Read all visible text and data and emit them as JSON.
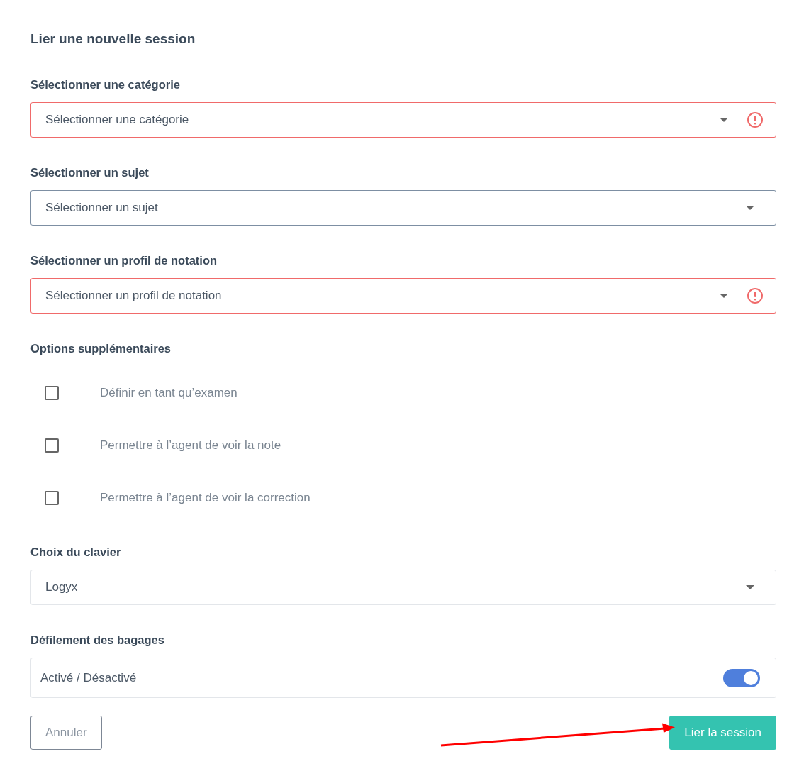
{
  "title": "Lier une nouvelle session",
  "selects": [
    {
      "label": "Sélectionner une catégorie",
      "placeholder": "Sélectionner une catégorie",
      "error": true,
      "focused": false
    },
    {
      "label": "Sélectionner un sujet",
      "placeholder": "Sélectionner un sujet",
      "error": false,
      "focused": true
    },
    {
      "label": "Sélectionner un profil de notation",
      "placeholder": "Sélectionner un profil de notation",
      "error": true,
      "focused": false
    }
  ],
  "options": {
    "label": "Options supplémentaires",
    "items": [
      {
        "label": "Définir en tant qu’examen",
        "checked": false
      },
      {
        "label": "Permettre à l’agent de voir la note",
        "checked": false
      },
      {
        "label": "Permettre à l’agent de voir la correction",
        "checked": false
      }
    ]
  },
  "keyboard": {
    "label": "Choix du clavier",
    "value": "Logyx"
  },
  "scrolling": {
    "label": "Défilement des bagages",
    "toggle_label": "Activé / Désactivé",
    "on": true
  },
  "buttons": {
    "cancel": "Annuler",
    "submit": "Lier la session"
  }
}
